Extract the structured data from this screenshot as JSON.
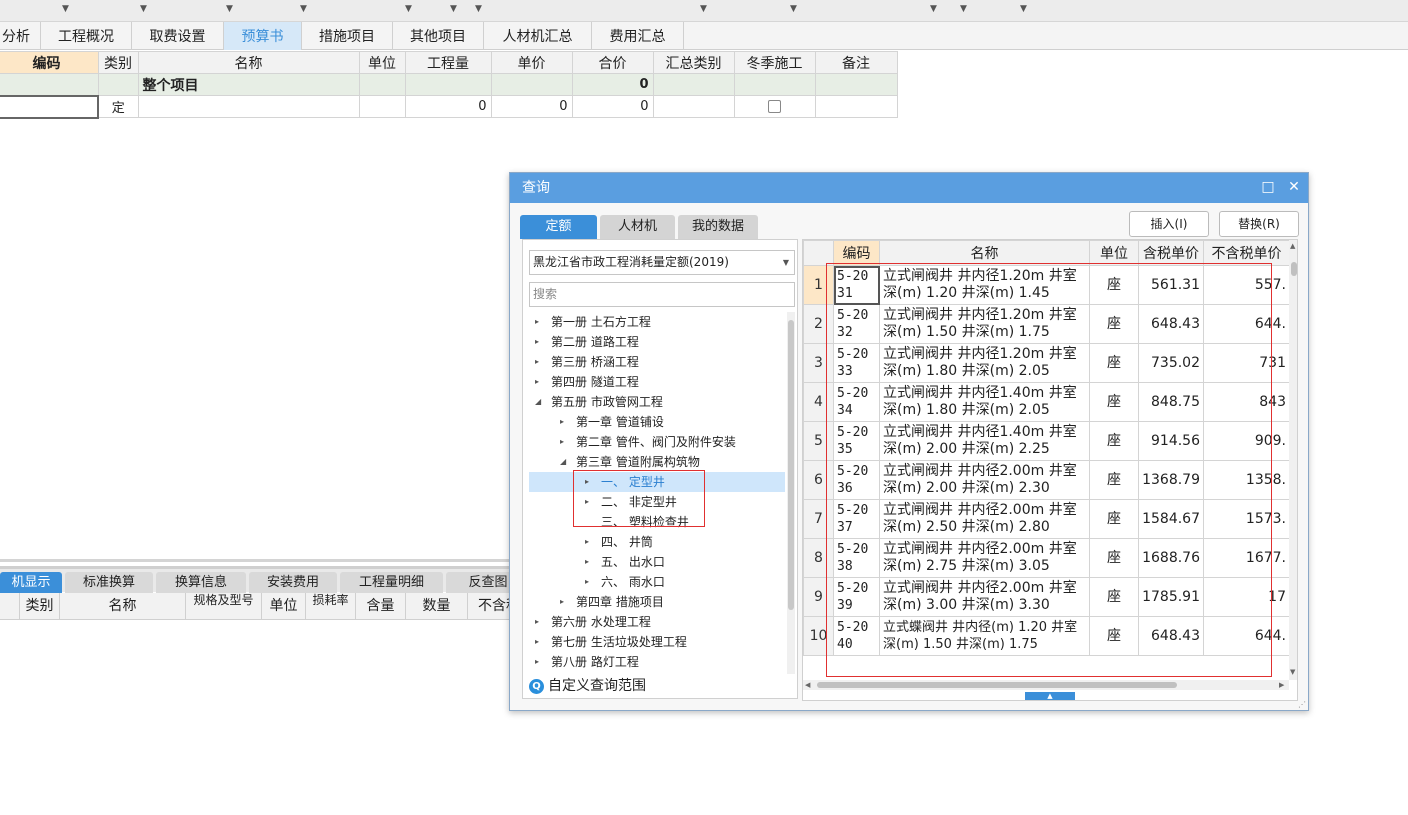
{
  "top_tabs": [
    {
      "label": "分析"
    },
    {
      "label": "工程概况"
    },
    {
      "label": "取费设置"
    },
    {
      "label": "预算书"
    },
    {
      "label": "措施项目"
    },
    {
      "label": "其他项目"
    },
    {
      "label": "人材机汇总"
    },
    {
      "label": "费用汇总"
    }
  ],
  "main_grid": {
    "headers": [
      "编码",
      "类别",
      "名称",
      "单位",
      "工程量",
      "单价",
      "合价",
      "汇总类别",
      "冬季施工",
      "备注"
    ],
    "summary_row": {
      "name": "整个项目",
      "total": "0"
    },
    "data_row": {
      "type": "定",
      "quantity": "0",
      "price": "0",
      "total": "0",
      "winter_checked": false
    }
  },
  "lower_tabs": [
    "机显示",
    "标准换算",
    "换算信息",
    "安装费用",
    "工程量明细",
    "反查图"
  ],
  "lower_headers": [
    "类别",
    "名称",
    "规格及型号",
    "单位",
    "损耗率",
    "含量",
    "数量",
    "不含税"
  ],
  "dialog": {
    "title": "查询",
    "tabs": [
      "定额",
      "人材机",
      "我的数据"
    ],
    "insert_label": "插入(I)",
    "replace_label": "替换(R)",
    "library_select": "黑龙江省市政工程消耗量定额(2019)",
    "search_placeholder": "搜索",
    "tree": [
      {
        "label": "第一册  土石方工程",
        "level": 0,
        "caret": "▸"
      },
      {
        "label": "第二册  道路工程",
        "level": 0,
        "caret": "▸"
      },
      {
        "label": "第三册  桥涵工程",
        "level": 0,
        "caret": "▸"
      },
      {
        "label": "第四册  隧道工程",
        "level": 0,
        "caret": "▸"
      },
      {
        "label": "第五册  市政管网工程",
        "level": 0,
        "caret": "◢"
      },
      {
        "label": "第一章  管道铺设",
        "level": 1,
        "caret": "▸"
      },
      {
        "label": "第二章  管件、阀门及附件安装",
        "level": 1,
        "caret": "▸"
      },
      {
        "label": "第三章  管道附属构筑物",
        "level": 1,
        "caret": "◢"
      },
      {
        "label": "一、  定型井",
        "level": 2,
        "caret": "▸",
        "selected": true
      },
      {
        "label": "二、  非定型井",
        "level": 2,
        "caret": "▸"
      },
      {
        "label": "三、  塑料检查井",
        "level": 2,
        "caret": ""
      },
      {
        "label": "四、  井筒",
        "level": 2,
        "caret": "▸"
      },
      {
        "label": "五、  出水口",
        "level": 2,
        "caret": "▸"
      },
      {
        "label": "六、  雨水口",
        "level": 2,
        "caret": "▸"
      },
      {
        "label": "第四章  措施项目",
        "level": 1,
        "caret": "▸"
      },
      {
        "label": "第六册  水处理工程",
        "level": 0,
        "caret": "▸"
      },
      {
        "label": "第七册  生活垃圾处理工程",
        "level": 0,
        "caret": "▸"
      },
      {
        "label": "第八册  路灯工程",
        "level": 0,
        "caret": "▸"
      }
    ],
    "custom_scope": "自定义查询范围",
    "grid_headers": [
      "",
      "编码",
      "名称",
      "单位",
      "含税单价",
      "不含税单价"
    ],
    "rows": [
      {
        "n": "1",
        "code": "5-2031",
        "name": "立式闸阀井 井内径1.20m 井室深(m) 1.20 井深(m) 1.45",
        "unit": "座",
        "tax_price": "561.31",
        "notax_price": "557."
      },
      {
        "n": "2",
        "code": "5-2032",
        "name": "立式闸阀井 井内径1.20m 井室深(m) 1.50 井深(m) 1.75",
        "unit": "座",
        "tax_price": "648.43",
        "notax_price": "644."
      },
      {
        "n": "3",
        "code": "5-2033",
        "name": "立式闸阀井 井内径1.20m 井室深(m) 1.80 井深(m) 2.05",
        "unit": "座",
        "tax_price": "735.02",
        "notax_price": "731"
      },
      {
        "n": "4",
        "code": "5-2034",
        "name": "立式闸阀井 井内径1.40m 井室深(m) 1.80 井深(m) 2.05",
        "unit": "座",
        "tax_price": "848.75",
        "notax_price": "843"
      },
      {
        "n": "5",
        "code": "5-2035",
        "name": "立式闸阀井 井内径1.40m 井室深(m) 2.00 井深(m) 2.25",
        "unit": "座",
        "tax_price": "914.56",
        "notax_price": "909."
      },
      {
        "n": "6",
        "code": "5-2036",
        "name": "立式闸阀井 井内径2.00m 井室深(m) 2.00 井深(m) 2.30",
        "unit": "座",
        "tax_price": "1368.79",
        "notax_price": "1358."
      },
      {
        "n": "7",
        "code": "5-2037",
        "name": "立式闸阀井 井内径2.00m 井室深(m) 2.50 井深(m) 2.80",
        "unit": "座",
        "tax_price": "1584.67",
        "notax_price": "1573."
      },
      {
        "n": "8",
        "code": "5-2038",
        "name": "立式闸阀井 井内径2.00m 井室深(m) 2.75 井深(m) 3.05",
        "unit": "座",
        "tax_price": "1688.76",
        "notax_price": "1677."
      },
      {
        "n": "9",
        "code": "5-2039",
        "name": "立式闸阀井 井内径2.00m 井室深(m) 3.00 井深(m) 3.30",
        "unit": "座",
        "tax_price": "1785.91",
        "notax_price": "17"
      },
      {
        "n": "10",
        "code": "5-2040",
        "name": "立式蝶阀井 井内径(m) 1.20 井室深(m) 1.50 井深(m) 1.75",
        "unit": "座",
        "tax_price": "648.43",
        "notax_price": "644."
      }
    ]
  },
  "colors": {
    "accent": "#3b8fd9",
    "title_bar": "#5a9ee0",
    "highlight": "#fde7c7",
    "annotation": "#e03030"
  }
}
